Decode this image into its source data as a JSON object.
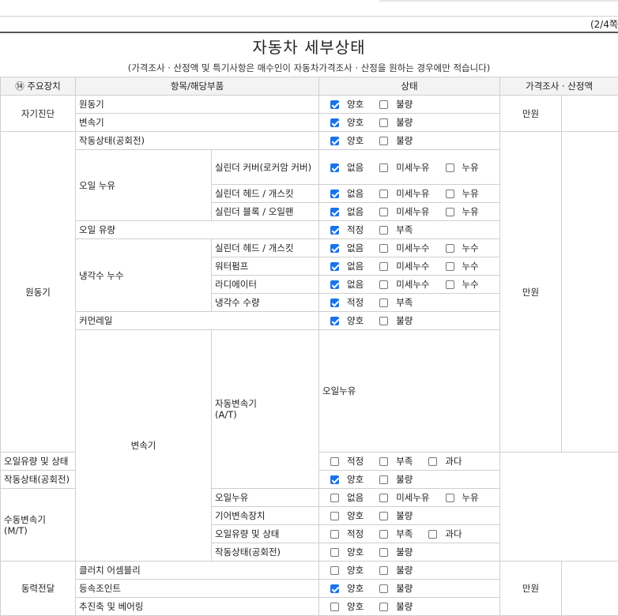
{
  "page": {
    "page_num": "(2/4쪽"
  },
  "doc": {
    "title": "자동차 세부상태",
    "subtitle": "(가격조사 · 산정액 및 특기사항은 매수인이 자동차가격조사 · 산정을 원하는 경우에만 적습니다)"
  },
  "header": {
    "col1": "⑭ 주요장치",
    "col2": "항목/해당부품",
    "col3": "상태",
    "col4": "가격조사 · 산정액"
  },
  "groups": {
    "selfdiag": "자기진단",
    "engine": "원동기",
    "trans": "변속기",
    "power": "동력전달"
  },
  "subgroups": {
    "oil_leak": "오일 누유",
    "coolant_leak": "냉각수 누수",
    "auto_trans": "자동변속기\n(A/T)",
    "manual_trans": "수동변속기\n(M/T)"
  },
  "price_unit": "만원",
  "rows": [
    {
      "item": "원동기",
      "opts": [
        [
          "양호",
          true
        ],
        [
          "불량",
          false
        ]
      ]
    },
    {
      "item": "변속기",
      "opts": [
        [
          "양호",
          true
        ],
        [
          "불량",
          false
        ]
      ]
    },
    {
      "item": "작동상태(공회전)",
      "opts": [
        [
          "양호",
          true
        ],
        [
          "불량",
          false
        ]
      ]
    },
    {
      "item": "실린더 커버(로커암 커버)",
      "opts": [
        [
          "없음",
          true
        ],
        [
          "미세누유",
          false
        ],
        [
          "누유",
          false
        ]
      ]
    },
    {
      "item": "실린더 헤드 / 개스킷",
      "opts": [
        [
          "없음",
          true
        ],
        [
          "미세누유",
          false
        ],
        [
          "누유",
          false
        ]
      ]
    },
    {
      "item": "실린더 블록 / 오일팬",
      "opts": [
        [
          "없음",
          true
        ],
        [
          "미세누유",
          false
        ],
        [
          "누유",
          false
        ]
      ]
    },
    {
      "item": "오일 유량",
      "opts": [
        [
          "적정",
          true
        ],
        [
          "부족",
          false
        ]
      ]
    },
    {
      "item": "실린더 헤드 / 개스킷",
      "opts": [
        [
          "없음",
          true
        ],
        [
          "미세누수",
          false
        ],
        [
          "누수",
          false
        ]
      ]
    },
    {
      "item": "워터펌프",
      "opts": [
        [
          "없음",
          true
        ],
        [
          "미세누수",
          false
        ],
        [
          "누수",
          false
        ]
      ]
    },
    {
      "item": "라디에이터",
      "opts": [
        [
          "없음",
          true
        ],
        [
          "미세누수",
          false
        ],
        [
          "누수",
          false
        ]
      ]
    },
    {
      "item": "냉각수 수량",
      "opts": [
        [
          "적정",
          true
        ],
        [
          "부족",
          false
        ]
      ]
    },
    {
      "item": "커먼레일",
      "opts": [
        [
          "양호",
          true
        ],
        [
          "불량",
          false
        ]
      ]
    },
    {
      "item": "오일누유",
      "opts": [
        [
          "없음",
          true
        ],
        [
          "미세누유",
          false
        ],
        [
          "누유",
          false
        ]
      ]
    },
    {
      "item": "오일유량 및 상태",
      "opts": [
        [
          "적정",
          false
        ],
        [
          "부족",
          false
        ],
        [
          "과다",
          false
        ]
      ]
    },
    {
      "item": "작동상태(공회전)",
      "opts": [
        [
          "양호",
          true
        ],
        [
          "불량",
          false
        ]
      ]
    },
    {
      "item": "오일누유",
      "opts": [
        [
          "없음",
          false
        ],
        [
          "미세누유",
          false
        ],
        [
          "누유",
          false
        ]
      ]
    },
    {
      "item": "기어변속장치",
      "opts": [
        [
          "양호",
          false
        ],
        [
          "불량",
          false
        ]
      ]
    },
    {
      "item": "오일유량 및 상태",
      "opts": [
        [
          "적정",
          false
        ],
        [
          "부족",
          false
        ],
        [
          "과다",
          false
        ]
      ]
    },
    {
      "item": "작동상태(공회전)",
      "opts": [
        [
          "양호",
          false
        ],
        [
          "불량",
          false
        ]
      ]
    },
    {
      "item": "클러치 어셈블리",
      "opts": [
        [
          "양호",
          false
        ],
        [
          "불량",
          false
        ]
      ]
    },
    {
      "item": "등속조인트",
      "opts": [
        [
          "양호",
          true
        ],
        [
          "불량",
          false
        ]
      ]
    },
    {
      "item": "추진축 및 베어링",
      "opts": [
        [
          "양호",
          false
        ],
        [
          "불량",
          false
        ]
      ]
    }
  ]
}
